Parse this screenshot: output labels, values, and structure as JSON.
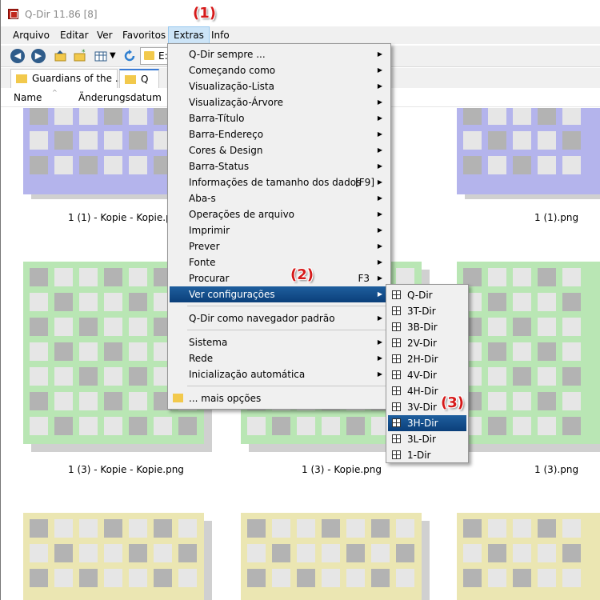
{
  "window": {
    "title": "Q-Dir 11.86 [8]"
  },
  "markers": {
    "m1": "(1)",
    "m2": "(2)",
    "m3": "(3)"
  },
  "menubar": {
    "items": [
      "Arquivo",
      "Editar",
      "Ver",
      "Favoritos",
      "Extras",
      "Info"
    ],
    "active_index": 4
  },
  "toolbar": {
    "icons": [
      "back-icon",
      "forward-icon",
      "up-folder-icon",
      "new-folder-icon",
      "view-mode-icon",
      "dropdown-icon",
      "refresh-icon"
    ],
    "address_text": "E:"
  },
  "tabs": [
    {
      "label": "Guardians of the ..."
    },
    {
      "label": "Q"
    }
  ],
  "columns": {
    "name": "Name",
    "date": "Änderungsdatum"
  },
  "files": [
    {
      "caption": "1 (1) - Kopie - Kopie.png",
      "color": "#b4b4ec"
    },
    {
      "caption": "1 (1).png",
      "color": "#b4b4ec"
    },
    {
      "caption": "1 (3) - Kopie - Kopie.png",
      "color": "#b9e6b4"
    },
    {
      "caption": "1 (3) - Kopie.png",
      "color": "#b9e6b4"
    },
    {
      "caption": "1 (3).png",
      "color": "#b9e6b4"
    }
  ],
  "extras_menu": {
    "items": [
      {
        "label": "Q-Dir sempre ...",
        "submenu": true
      },
      {
        "label": "Começando como",
        "submenu": true
      },
      {
        "label": "Visualização-Lista",
        "submenu": true
      },
      {
        "label": "Visualização-Árvore",
        "submenu": true
      },
      {
        "label": "Barra-Título",
        "submenu": true
      },
      {
        "label": "Barra-Endereço",
        "submenu": true
      },
      {
        "label": "Cores & Design",
        "submenu": true
      },
      {
        "label": "Barra-Status",
        "submenu": true
      },
      {
        "label": "Informações de tamanho dos dados",
        "shortcut": "[F9]",
        "submenu": true
      },
      {
        "label": "Aba-s",
        "submenu": true
      },
      {
        "label": "Operações de arquivo",
        "submenu": true
      },
      {
        "label": "Imprimir",
        "submenu": true
      },
      {
        "label": "Prever",
        "submenu": true
      },
      {
        "label": "Fonte",
        "submenu": true
      },
      {
        "label": "Procurar",
        "shortcut": "F3",
        "submenu": true
      },
      {
        "label": "Ver configurações",
        "submenu": true,
        "highlighted": true
      },
      {
        "label": "Q-Dir como navegador padrão",
        "submenu": true
      },
      {
        "label": "Sistema",
        "submenu": true
      },
      {
        "label": "Rede",
        "submenu": true
      },
      {
        "label": "Inicialização automática",
        "submenu": true
      },
      {
        "label": "... mais opções",
        "submenu": false
      }
    ]
  },
  "view_submenu": {
    "items": [
      {
        "label": "Q-Dir",
        "icon": "quad-layout-icon"
      },
      {
        "label": "3T-Dir",
        "icon": "3t-layout-icon"
      },
      {
        "label": "3B-Dir",
        "icon": "3b-layout-icon"
      },
      {
        "label": "2V-Dir",
        "icon": "2v-layout-icon"
      },
      {
        "label": "2H-Dir",
        "icon": "2h-layout-icon"
      },
      {
        "label": "4V-Dir",
        "icon": "4v-layout-icon"
      },
      {
        "label": "4H-Dir",
        "icon": "4h-layout-icon"
      },
      {
        "label": "3V-Dir",
        "icon": "3v-layout-icon"
      },
      {
        "label": "3H-Dir",
        "icon": "3h-layout-icon",
        "highlighted": true
      },
      {
        "label": "3L-Dir",
        "icon": "3l-layout-icon"
      },
      {
        "label": "1-Dir",
        "icon": "single-layout-icon"
      }
    ]
  }
}
